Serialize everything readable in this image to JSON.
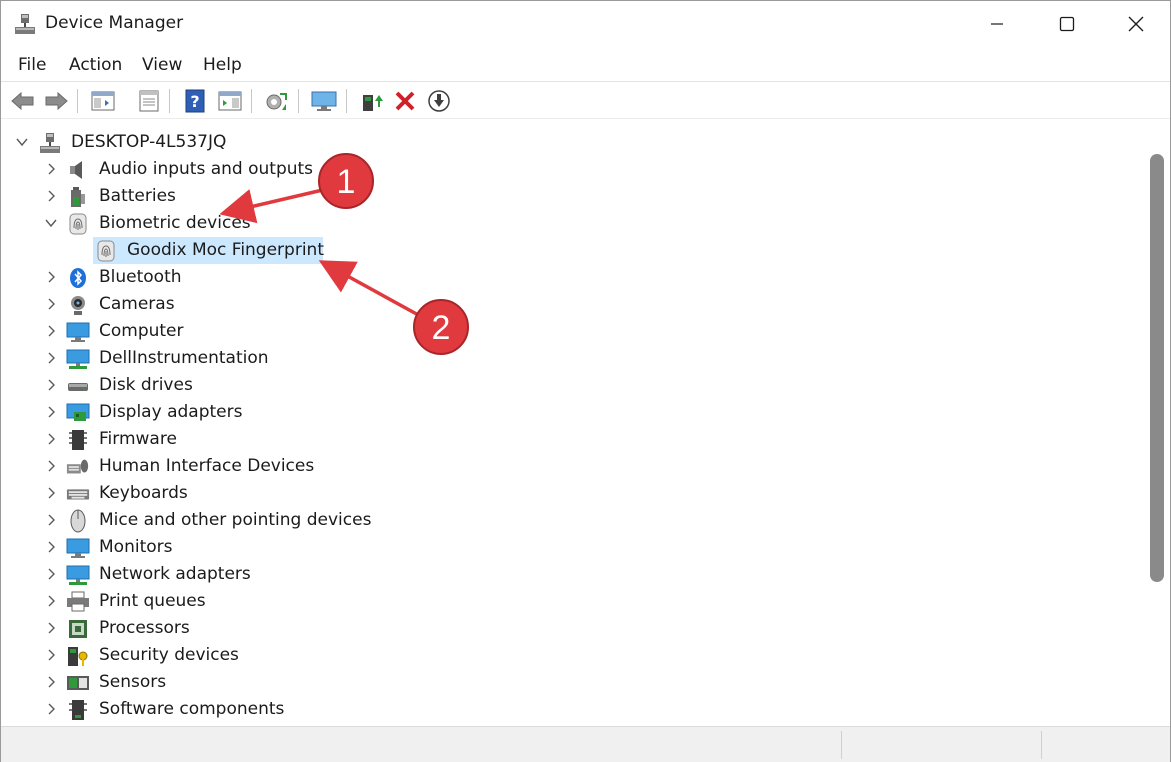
{
  "window": {
    "title": "Device Manager"
  },
  "menu": [
    "File",
    "Action",
    "View",
    "Help"
  ],
  "toolbar": [
    "back-icon",
    "forward-icon",
    "show-hide-console-tree-icon",
    "properties-icon",
    "help-icon",
    "action-pane-icon",
    "scan-hardware-icon",
    "monitor-icon",
    "update-driver-icon",
    "uninstall-icon",
    "download-icon"
  ],
  "tree": {
    "root": "DESKTOP-4L537JQ",
    "items": [
      {
        "label": "Audio inputs and outputs",
        "icon": "speaker-icon",
        "expanded": false
      },
      {
        "label": "Batteries",
        "icon": "battery-icon",
        "expanded": false
      },
      {
        "label": "Biometric devices",
        "icon": "fingerprint-icon",
        "expanded": true
      },
      {
        "label": "Goodix Moc Fingerprint",
        "icon": "fingerprint-icon",
        "child": true,
        "selected": true
      },
      {
        "label": "Bluetooth",
        "icon": "bluetooth-icon",
        "expanded": false
      },
      {
        "label": "Cameras",
        "icon": "camera-icon",
        "expanded": false
      },
      {
        "label": "Computer",
        "icon": "computer-icon",
        "expanded": false
      },
      {
        "label": "DellInstrumentation",
        "icon": "network-monitor-icon",
        "expanded": false
      },
      {
        "label": "Disk drives",
        "icon": "disk-drive-icon",
        "expanded": false
      },
      {
        "label": "Display adapters",
        "icon": "display-adapter-icon",
        "expanded": false
      },
      {
        "label": "Firmware",
        "icon": "firmware-chip-icon",
        "expanded": false
      },
      {
        "label": "Human Interface Devices",
        "icon": "hid-icon",
        "expanded": false
      },
      {
        "label": "Keyboards",
        "icon": "keyboard-icon",
        "expanded": false
      },
      {
        "label": "Mice and other pointing devices",
        "icon": "mouse-icon",
        "expanded": false
      },
      {
        "label": "Monitors",
        "icon": "monitor-icon",
        "expanded": false
      },
      {
        "label": "Network adapters",
        "icon": "network-adapter-icon",
        "expanded": false
      },
      {
        "label": "Print queues",
        "icon": "printer-icon",
        "expanded": false
      },
      {
        "label": "Processors",
        "icon": "processor-icon",
        "expanded": false
      },
      {
        "label": "Security devices",
        "icon": "security-key-icon",
        "expanded": false
      },
      {
        "label": "Sensors",
        "icon": "sensor-icon",
        "expanded": false
      },
      {
        "label": "Software components",
        "icon": "software-component-icon",
        "expanded": false
      }
    ]
  },
  "annotations": [
    "1",
    "2"
  ],
  "colors": {
    "selection": "#cce8ff",
    "annotation": "#e0393e"
  }
}
